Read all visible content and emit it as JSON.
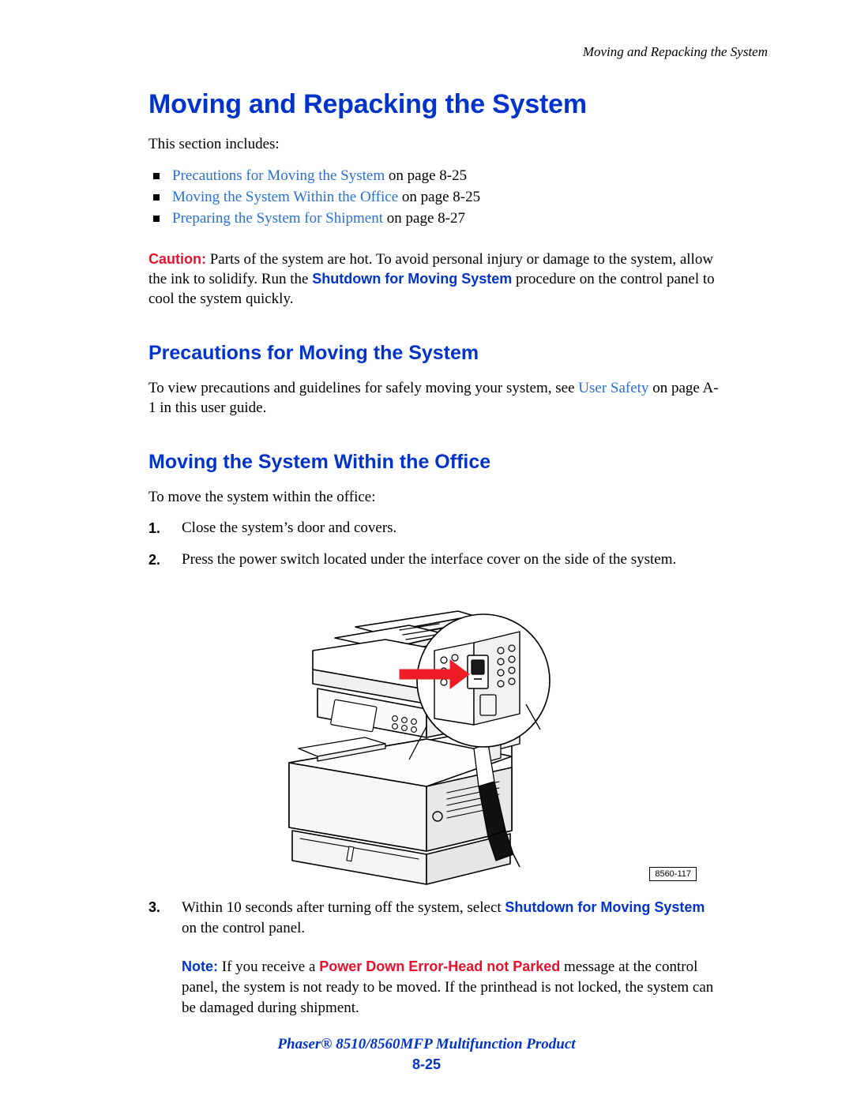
{
  "running_head": "Moving and Repacking the System",
  "title": "Moving and Repacking the System",
  "intro": "This section includes:",
  "toc": [
    {
      "link": "Precautions for Moving the System",
      "tail": " on page 8-25"
    },
    {
      "link": "Moving the System Within the Office",
      "tail": " on page 8-25"
    },
    {
      "link": "Preparing the System for Shipment",
      "tail": " on page 8-27"
    }
  ],
  "caution": {
    "label": "Caution:",
    "text_1": " Parts of the system are hot. To avoid personal injury or damage to the system, allow the ink to solidify. Run the ",
    "bold": "Shutdown for Moving System",
    "text_2": " procedure on the control panel to cool the system quickly."
  },
  "section_precautions": {
    "heading": "Precautions for Moving the System",
    "text_1": "To view precautions and guidelines for safely moving your system, see ",
    "link": "User Safety",
    "text_2": " on page A-1 in this user guide."
  },
  "section_moving": {
    "heading": "Moving the System Within the Office",
    "lead": "To move the system within the office:",
    "steps": [
      {
        "num": "1.",
        "text": "Close the system’s door and covers."
      },
      {
        "num": "2.",
        "text": "Press the power switch located under the interface cover on the side of the system."
      }
    ]
  },
  "figure": {
    "id_label": "8560-117",
    "alt": "Illustration of the Phaser 8510/8560MFP with callout magnifying the power switch under the interface cover"
  },
  "step3": {
    "num": "3.",
    "text_1": "Within 10 seconds after turning off the system, select ",
    "bold": "Shutdown for Moving System",
    "text_2": " on the control panel."
  },
  "note": {
    "label": "Note:",
    "text_1": " If you receive a ",
    "bold_red": "Power Down Error-Head not Parked",
    "text_2": " message at the control panel, the system is not ready to be moved. If the printhead is not locked, the system can be damaged during shipment."
  },
  "footer": {
    "product": "Phaser® 8510/8560MFP Multifunction Product",
    "page_number": "8-25"
  },
  "colors": {
    "heading_blue": "#0033cc",
    "link_blue": "#2a6fd6",
    "alert_red": "#e8112d",
    "arrow_red": "#ee1c25"
  }
}
